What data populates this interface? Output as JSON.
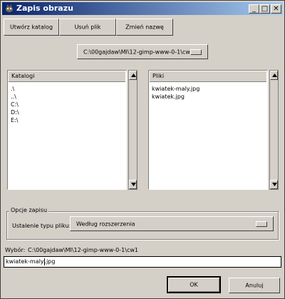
{
  "window": {
    "title": "Zapis obrazu",
    "controls": {
      "minimize": "_",
      "maximize": "□",
      "close": "✕"
    }
  },
  "toolbar": {
    "create_dir": "Utwórz katalog",
    "delete_file": "Usuń plik",
    "rename": "Zmień nazwę"
  },
  "path_selector": {
    "value": "C:\\00gajdaw\\MI\\12-gimp-www-0-1\\cw1"
  },
  "directories": {
    "header": "Katalogi",
    "items": [
      ".\\",
      "..\\",
      "C:\\",
      "D:\\",
      "E:\\"
    ]
  },
  "files": {
    "header": "Pliki",
    "items": [
      "kwiatek-maly.jpg",
      "kwiatek.jpg"
    ]
  },
  "save_options": {
    "legend": "Opcje zapisu",
    "type_label": "Ustalenie typu pliku:",
    "type_value": "Według rozszerzenia"
  },
  "selection": {
    "label": "Wybór:",
    "path": "C:\\00gajdaw\\MI\\12-gimp-www-0-1\\cw1",
    "filename_before_caret": "kwiatek-maly",
    "filename_after_caret": ".jpg"
  },
  "actions": {
    "ok": "OK",
    "cancel": "Anuluj"
  }
}
